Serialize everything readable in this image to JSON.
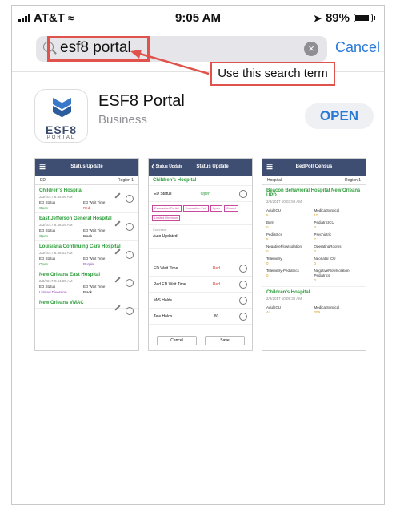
{
  "status_bar": {
    "carrier": "AT&T",
    "time": "9:05 AM",
    "battery": "89%",
    "battery_level": 0.89
  },
  "search": {
    "value": "esf8 portal",
    "cancel_label": "Cancel"
  },
  "annotation": {
    "callout": "Use this search term"
  },
  "app": {
    "icon_name": "ESF8",
    "icon_sub": "PORTAL",
    "title": "ESF8 Portal",
    "category": "Business",
    "open_label": "OPEN"
  },
  "colors": {
    "accent": "#2a7ad7",
    "annotation": "#e0524c",
    "header": "#3e4d72",
    "status_green": "#2e9d3b"
  },
  "shot1": {
    "title": "Status Update",
    "left": "ED",
    "right": "Region 1",
    "cards": [
      {
        "name": "Children's Hospital",
        "date": "2/3/2017 8:44:06 AM",
        "k1": "ED Status",
        "v1": "Open",
        "k2": "ED Wait Time",
        "v2": "Red"
      },
      {
        "name": "East Jefferson General Hospital",
        "date": "2/3/2017 8:38:28 AM",
        "k1": "ED Status",
        "v1": "Open",
        "k2": "ED Wait Time",
        "v2": "Black"
      },
      {
        "name": "Louisiana Continuing Care Hospital",
        "date": "2/3/2017 8:38:02 AM",
        "k1": "ED Status",
        "v1": "Open",
        "k2": "ED Wait Time",
        "v2": "Purple"
      },
      {
        "name": "New Orleans East Hospital",
        "date": "2/3/2017 9:44:25 AM",
        "k1": "ED Status",
        "v1": "Limited Diversion",
        "k2": "ED Wait Time",
        "v2": "Black"
      },
      {
        "name": "New Orleans VMAC",
        "date": "",
        "k1": "",
        "v1": "",
        "k2": "",
        "v2": ""
      }
    ]
  },
  "shot2": {
    "back": "Status Update",
    "title": "Status Update",
    "hospital": "Children's Hospital",
    "ed_status_label": "ED Status",
    "ed_status_value": "Open",
    "tags": [
      "Evacuation Partial",
      "Evacuation Full",
      "Open",
      "Closed",
      "Limited Diversion"
    ],
    "comment_label": "Comment",
    "comment_value": "Auto Updated",
    "rows": [
      {
        "label": "ED Wait Time",
        "value": "Red"
      },
      {
        "label": "Ped ED Wait Time",
        "value": "Red"
      },
      {
        "label": "M/S Holds",
        "value": ""
      },
      {
        "label": "Tele Holds",
        "value": "80"
      }
    ],
    "cancel": "Cancel",
    "save": "Save"
  },
  "shot3": {
    "title": "BedPoll Census",
    "left": "Hospital",
    "right": "Region 1",
    "hospital": "Beacon Behavioral Hospital New Orleans UPD",
    "date": "2/8/2017 10:03:59 AM",
    "cells": [
      {
        "k": "AdultICU",
        "v": "5"
      },
      {
        "k": "MedicalSurgical",
        "v": "10"
      },
      {
        "k": "Burn",
        "v": "0"
      },
      {
        "k": "PediatricICU",
        "v": "3"
      },
      {
        "k": "Pediatrics",
        "v": "8"
      },
      {
        "k": "Psychiatric",
        "v": "7"
      },
      {
        "k": "NegativeFlowIsolation",
        "v": "0"
      },
      {
        "k": "OperatingRooms",
        "v": "0"
      },
      {
        "k": "Telemetry",
        "v": "0"
      },
      {
        "k": "Neonatal ICU",
        "v": "0"
      },
      {
        "k": "Telemetry-Pediatrics",
        "v": "0"
      },
      {
        "k": "NegativeFlowIsolation-Pediatrics",
        "v": "0"
      }
    ],
    "hospital2": "Children's Hospital",
    "date2": "2/8/2017 10:05:32 AM",
    "cells2": [
      {
        "k": "AdultICU",
        "v": "44"
      },
      {
        "k": "MedicalSurgical",
        "v": "209"
      }
    ]
  }
}
